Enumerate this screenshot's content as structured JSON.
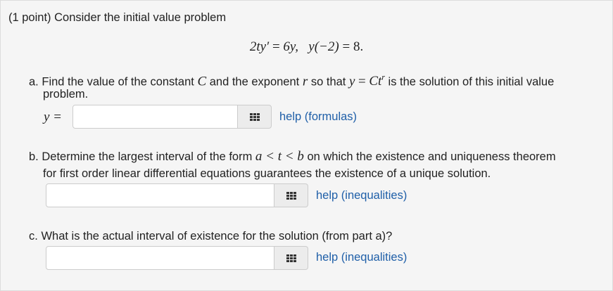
{
  "header": {
    "point_label": "(1 point)",
    "intro": "Consider the initial value problem"
  },
  "equation": {
    "lhs": "2ty′",
    "eq1": " = ",
    "rhs": "6y,",
    "cond": "y(−2)",
    "eq2": " = ",
    "cond_val": "8."
  },
  "part_a": {
    "marker": "a.",
    "text1": "Find the value of the constant",
    "C": "C",
    "text2": "and the exponent",
    "r": "r",
    "text3": "so that",
    "y": "y",
    "eq": "=",
    "Ct": "Ct",
    "r_sup": "r",
    "text4": "is the solution of this initial value",
    "text5": "problem.",
    "answer_label": "y =",
    "input_value": "",
    "help_link": "help (formulas)"
  },
  "part_b": {
    "marker": "b.",
    "text1": "Determine the largest interval of the form",
    "interval": "a < t < b",
    "text2": "on which the existence and uniqueness theorem",
    "text3": "for first order linear differential equations guarantees the existence of a unique solution.",
    "input_value": "",
    "help_link": "help (inequalities)"
  },
  "part_c": {
    "marker": "c.",
    "text1": "What is the actual interval of existence for the solution (from part a)?",
    "input_value": "",
    "help_link": "help (inequalities)"
  },
  "icons": {
    "keyboard": "grid-keypad-icon"
  },
  "colors": {
    "link": "#1f5fa8",
    "background": "#f5f5f5"
  }
}
